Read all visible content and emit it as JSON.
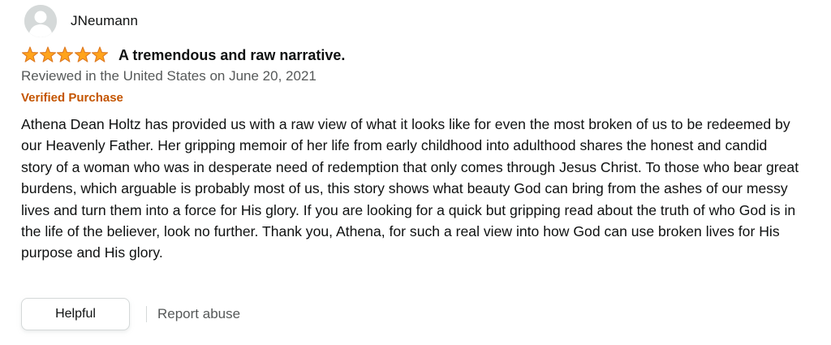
{
  "review": {
    "profile": {
      "name": "JNeumann",
      "avatar_icon": "default-profile-icon"
    },
    "rating": {
      "stars": 5,
      "max": 5,
      "star_color": "#ffa41c",
      "star_outline_color": "#de7921"
    },
    "title": "A tremendous and raw narrative.",
    "date_text": "Reviewed in the United States on June 20, 2021",
    "badge": {
      "label": "Verified Purchase",
      "color": "#c45500"
    },
    "body": "Athena Dean Holtz has provided us with a raw view of what it looks like for even the most broken of us to be redeemed by our Heavenly Father. Her gripping memoir of her life from early childhood into adulthood shares the honest and candid story of a woman who was in desperate need of redemption that only comes through Jesus Christ. To those who bear great burdens, which arguable is probably most of us, this story shows what beauty God can bring from the ashes of our messy lives and turn them into a force for His glory. If you are looking for a quick but gripping read about the truth of who God is in the life of the believer, look no further. Thank you, Athena, for such a real view into how God can use broken lives for His purpose and His glory.",
    "actions": {
      "helpful_label": "Helpful",
      "report_label": "Report abuse"
    }
  }
}
